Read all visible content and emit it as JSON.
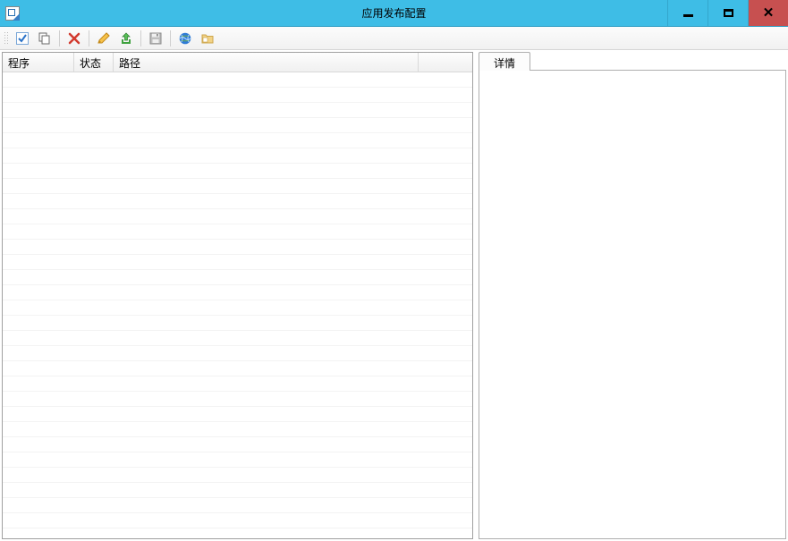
{
  "window": {
    "title": "应用发布配置"
  },
  "columns": {
    "program": "程序",
    "status": "状态",
    "path": "路径"
  },
  "detail": {
    "tab": "详情"
  },
  "toolbar": {
    "select_all": "select-all",
    "copy": "copy",
    "delete": "delete",
    "edit": "edit",
    "export": "export",
    "save": "save",
    "web": "web",
    "folder": "folder"
  }
}
